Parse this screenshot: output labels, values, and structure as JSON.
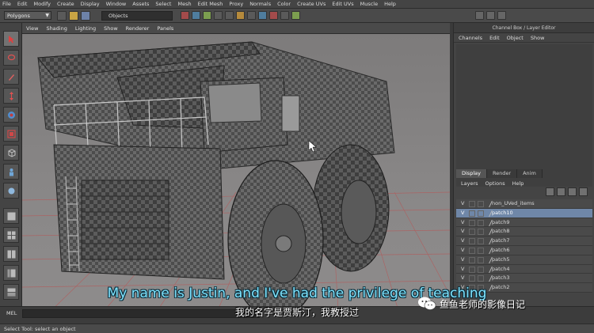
{
  "menubar": {
    "items": [
      "File",
      "Edit",
      "Modify",
      "Create",
      "Display",
      "Window",
      "Assets",
      "Select",
      "Mesh",
      "Edit Mesh",
      "Proxy",
      "Normals",
      "Color",
      "Create UVs",
      "Edit UVs",
      "Muscle",
      "Help"
    ]
  },
  "statusline": {
    "mode": "Polygons",
    "object_field": "Objects"
  },
  "viewport": {
    "menu": [
      "View",
      "Shading",
      "Lighting",
      "Show",
      "Renderer",
      "Panels"
    ]
  },
  "channel_box": {
    "title": "Channel Box / Layer Editor",
    "menu": [
      "Channels",
      "Edit",
      "Object",
      "Show"
    ]
  },
  "layer_editor": {
    "tabs": [
      "Display",
      "Render",
      "Anim"
    ],
    "menu": [
      "Layers",
      "Options",
      "Help"
    ],
    "layers": [
      {
        "visible": "V",
        "name": "non_UVed_items",
        "selected": false
      },
      {
        "visible": "V",
        "name": "patch10",
        "selected": true
      },
      {
        "visible": "V",
        "name": "patch9",
        "selected": false
      },
      {
        "visible": "V",
        "name": "patch8",
        "selected": false
      },
      {
        "visible": "V",
        "name": "patch7",
        "selected": false
      },
      {
        "visible": "V",
        "name": "patch6",
        "selected": false
      },
      {
        "visible": "V",
        "name": "patch5",
        "selected": false
      },
      {
        "visible": "V",
        "name": "patch4",
        "selected": false
      },
      {
        "visible": "V",
        "name": "patch3",
        "selected": false
      },
      {
        "visible": "V",
        "name": "patch2",
        "selected": false
      }
    ]
  },
  "command_line": {
    "label": "MEL"
  },
  "help_line": {
    "text": "Select Tool: select an object"
  },
  "subtitles": {
    "english": "My name is Justin, and I've had the privilege of teaching",
    "chinese": "我的名字是贾斯汀，我教授过"
  },
  "watermark": {
    "text": "鱼鱼老师的影像日记"
  },
  "colors": {
    "selection": "#6f87a8",
    "subtitle_en": "#7fe4ff",
    "grid_lines": "#b55858"
  }
}
